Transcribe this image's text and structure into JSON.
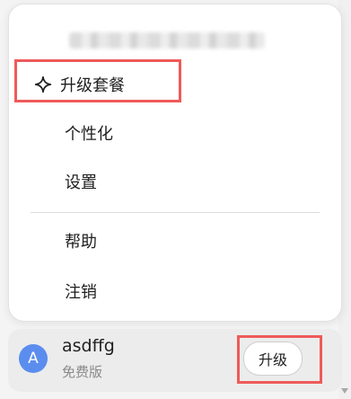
{
  "menu": {
    "items": [
      {
        "label": "升级套餐",
        "icon": "sparkle-icon"
      },
      {
        "label": "个性化"
      },
      {
        "label": "设置"
      },
      {
        "label": "帮助"
      },
      {
        "label": "注销"
      }
    ]
  },
  "account": {
    "avatar_initial": "A",
    "username": "asdffg",
    "plan": "免费版",
    "upgrade_label": "升级"
  },
  "colors": {
    "highlight": "#ef5a5a",
    "avatar": "#5b8def"
  }
}
